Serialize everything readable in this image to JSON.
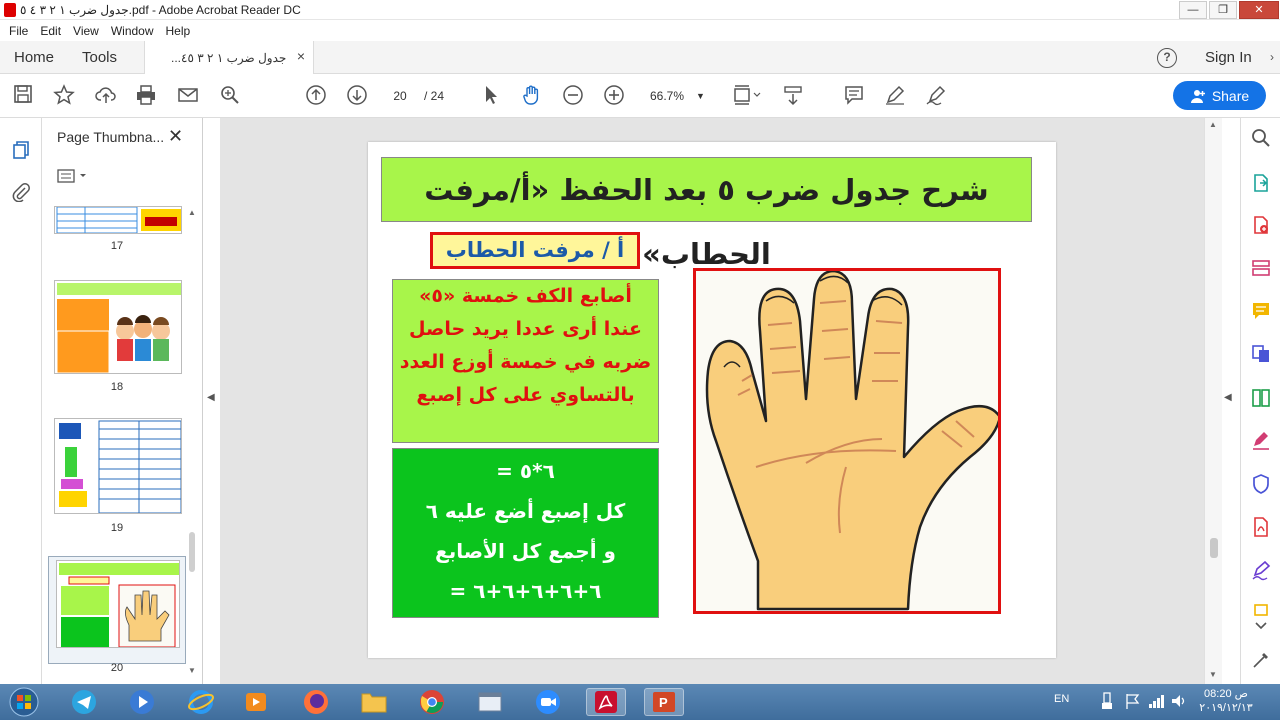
{
  "window": {
    "title": "‏جدول ضرب ١ ٢ ٣ ٤ ٥.pdf - Adobe Acrobat Reader DC",
    "controls": [
      "—",
      "❐",
      "✕"
    ]
  },
  "menu": [
    "File",
    "Edit",
    "View",
    "Window",
    "Help"
  ],
  "tabs": {
    "home": "Home",
    "tools": "Tools",
    "document": "جدول ضرب ١ ٢ ٣ ٤٥...",
    "close": "×"
  },
  "header": {
    "help": "?",
    "sign_in": "Sign In",
    "more": "›"
  },
  "toolbar": {
    "current_page": "20",
    "total_pages": "/ 24",
    "zoom": "66.7%",
    "share": "Share"
  },
  "thumbnails": {
    "title": "Page Thumbna...",
    "close": "✕",
    "pages": [
      {
        "label": "17"
      },
      {
        "label": "18"
      },
      {
        "label": "19"
      },
      {
        "label": "20"
      }
    ],
    "selected": "20"
  },
  "pdf_page": {
    "title": "شرح جدول ضرب ٥ بعد الحفظ «أ/مرفت الحطاب»",
    "author": "أ / مرفت الحطاب",
    "box1_lines": [
      "أصابع الكف خمسة «٥»",
      "عندا أرى عددا يريد حاصل",
      "ضربه في خمسة أوزع العدد",
      "بالتساوي على كل إصبع"
    ],
    "box2_lines": [
      "٦*٥ =",
      "كل إصبع أضع عليه ٦",
      "و أجمع كل الأصابع",
      "٦+٦+٦+٦+٦ ="
    ]
  },
  "taskbar": {
    "lang": "EN",
    "time": "08:20 ص",
    "date": "٢٠١٩/١٢/١٣"
  },
  "colors": {
    "share_blue": "#1473e6",
    "green_light": "#a8f54a",
    "green_dark": "#0bc41d",
    "red": "#e01010",
    "yellow": "#fff69a"
  }
}
